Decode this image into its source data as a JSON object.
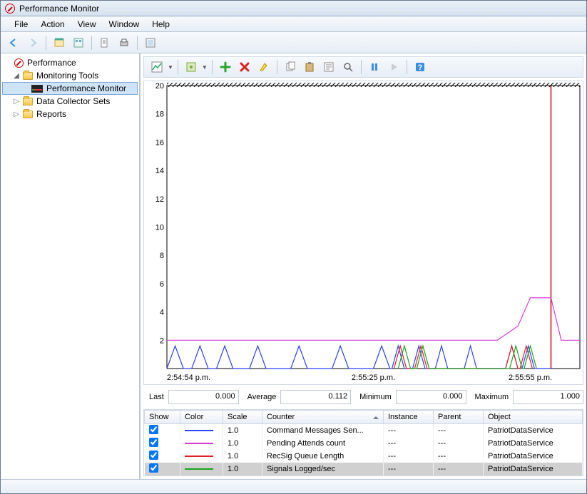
{
  "window": {
    "title": "Performance Monitor"
  },
  "menu": {
    "file": "File",
    "action": "Action",
    "view": "View",
    "window": "Window",
    "help": "Help"
  },
  "tree": {
    "root": "Performance",
    "monitoring_tools": "Monitoring Tools",
    "perf_monitor": "Performance Monitor",
    "data_collector_sets": "Data Collector Sets",
    "reports": "Reports"
  },
  "stats": {
    "last_label": "Last",
    "last_value": "0.000",
    "avg_label": "Average",
    "avg_value": "0.112",
    "min_label": "Minimum",
    "min_value": "0.000",
    "max_label": "Maximum",
    "max_value": "1.000"
  },
  "counter_headers": {
    "show": "Show",
    "color": "Color",
    "scale": "Scale",
    "counter": "Counter",
    "instance": "Instance",
    "parent": "Parent",
    "object": "Object"
  },
  "counters": [
    {
      "show": true,
      "color": "#2a3fff",
      "scale": "1.0",
      "counter": "Command Messages Sen...",
      "instance": "---",
      "parent": "---",
      "object": "PatriotDataService",
      "selected": false
    },
    {
      "show": true,
      "color": "#d63cd6",
      "scale": "1.0",
      "counter": "Pending Attends count",
      "instance": "---",
      "parent": "---",
      "object": "PatriotDataService",
      "selected": false
    },
    {
      "show": true,
      "color": "#e02020",
      "scale": "1.0",
      "counter": "RecSig Queue Length",
      "instance": "---",
      "parent": "---",
      "object": "PatriotDataService",
      "selected": false
    },
    {
      "show": true,
      "color": "#1aa31a",
      "scale": "1.0",
      "counter": "Signals Logged/sec",
      "instance": "---",
      "parent": "---",
      "object": "PatriotDataService",
      "selected": true
    }
  ],
  "chart_data": {
    "type": "line",
    "ylim": [
      0,
      20
    ],
    "yticks": [
      2,
      4,
      6,
      8,
      10,
      12,
      14,
      16,
      18,
      20
    ],
    "x_labels": [
      "2:54:54 p.m.",
      "2:55:25 p.m.",
      "2:55:55 p.m."
    ],
    "x_label_fractions": [
      0.0,
      0.5,
      0.88
    ],
    "timebar_fraction": 0.93,
    "series": [
      {
        "name": "Pending Attends count",
        "color": "#d63cd6",
        "points": [
          [
            0,
            2
          ],
          [
            0.8,
            2
          ],
          [
            0.85,
            3
          ],
          [
            0.88,
            5
          ],
          [
            0.93,
            5
          ],
          [
            0.955,
            2
          ],
          [
            1.0,
            2
          ]
        ]
      },
      {
        "name": "Command Messages Sent/sec",
        "color": "#2a3fff",
        "points": [
          [
            0.0,
            0
          ],
          [
            0.02,
            1.6
          ],
          [
            0.04,
            0
          ],
          [
            0.06,
            0
          ],
          [
            0.08,
            1.6
          ],
          [
            0.1,
            0
          ],
          [
            0.12,
            0
          ],
          [
            0.14,
            1.6
          ],
          [
            0.16,
            0
          ],
          [
            0.2,
            0
          ],
          [
            0.22,
            1.6
          ],
          [
            0.24,
            0
          ],
          [
            0.3,
            0
          ],
          [
            0.32,
            1.6
          ],
          [
            0.34,
            0
          ],
          [
            0.4,
            0
          ],
          [
            0.42,
            1.6
          ],
          [
            0.44,
            0
          ],
          [
            0.5,
            0
          ],
          [
            0.52,
            1.6
          ],
          [
            0.54,
            0
          ],
          [
            0.545,
            0
          ],
          [
            0.56,
            1.6
          ],
          [
            0.575,
            0
          ],
          [
            0.595,
            0
          ],
          [
            0.61,
            1.6
          ],
          [
            0.625,
            0
          ],
          [
            0.65,
            0
          ],
          [
            0.665,
            1.6
          ],
          [
            0.68,
            0
          ],
          [
            0.72,
            0
          ],
          [
            0.735,
            1.6
          ],
          [
            0.75,
            0
          ],
          [
            0.82,
            0
          ],
          [
            0.835,
            1.6
          ],
          [
            0.85,
            0
          ],
          [
            0.86,
            0
          ],
          [
            0.875,
            1.6
          ],
          [
            0.89,
            0
          ],
          [
            0.93,
            0
          ]
        ]
      },
      {
        "name": "RecSig Queue Length",
        "color": "#e02020",
        "points": [
          [
            0.55,
            0
          ],
          [
            0.565,
            1.6
          ],
          [
            0.58,
            0
          ],
          [
            0.6,
            0
          ],
          [
            0.615,
            1.6
          ],
          [
            0.63,
            0
          ],
          [
            0.82,
            0
          ],
          [
            0.835,
            1.6
          ],
          [
            0.85,
            0
          ],
          [
            0.855,
            0
          ],
          [
            0.87,
            1.6
          ],
          [
            0.885,
            0
          ]
        ]
      },
      {
        "name": "Signals Logged/sec",
        "color": "#1aa31a",
        "points": [
          [
            0.56,
            0
          ],
          [
            0.575,
            1.6
          ],
          [
            0.59,
            0
          ],
          [
            0.605,
            0
          ],
          [
            0.62,
            1.6
          ],
          [
            0.635,
            0
          ],
          [
            0.83,
            0
          ],
          [
            0.845,
            1.6
          ],
          [
            0.86,
            0
          ],
          [
            0.865,
            0
          ],
          [
            0.88,
            1.6
          ],
          [
            0.895,
            0
          ]
        ]
      }
    ]
  }
}
